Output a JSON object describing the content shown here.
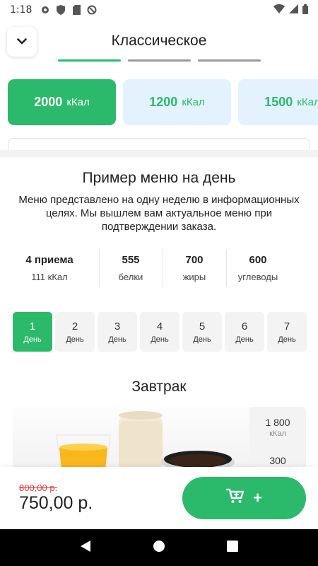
{
  "status_bar": {
    "time": "1:18"
  },
  "header": {
    "title": "Классическое"
  },
  "calorie_options": [
    {
      "value": "2000",
      "unit": "кКал",
      "active": true
    },
    {
      "value": "1200",
      "unit": "кКал",
      "active": false
    },
    {
      "value": "1500",
      "unit": "кКал",
      "active": false
    }
  ],
  "menu": {
    "title": "Пример меню на день",
    "description": "Меню представлено на одну неделю в информационных целях. Мы вышлем вам актуальное меню при подтверждении заказа.",
    "stats": [
      {
        "value": "4 приема",
        "label": "111 кКал"
      },
      {
        "value": "555",
        "label": "белки"
      },
      {
        "value": "700",
        "label": "жиры"
      },
      {
        "value": "600",
        "label": "углеводы"
      }
    ],
    "days": [
      {
        "num": "1",
        "label": "День"
      },
      {
        "num": "2",
        "label": "День"
      },
      {
        "num": "3",
        "label": "День"
      },
      {
        "num": "4",
        "label": "День"
      },
      {
        "num": "5",
        "label": "День"
      },
      {
        "num": "6",
        "label": "День"
      },
      {
        "num": "7",
        "label": "День"
      }
    ],
    "meal_title": "Завтрак",
    "meal_nutrition": {
      "kcal": "1 800",
      "kcal_label": "кКал",
      "protein": "300"
    }
  },
  "order": {
    "old_price": "800,00 р.",
    "price": "750,00 р.",
    "add_label": "+"
  },
  "colors": {
    "accent": "#2bba6b",
    "chip_bg": "#e3f2fd",
    "strike": "#e53935"
  },
  "icons": {
    "back": "chevron-down-icon",
    "cart": "cart-icon",
    "nav": [
      "back-triangle-icon",
      "home-circle-icon",
      "recents-square-icon"
    ]
  }
}
